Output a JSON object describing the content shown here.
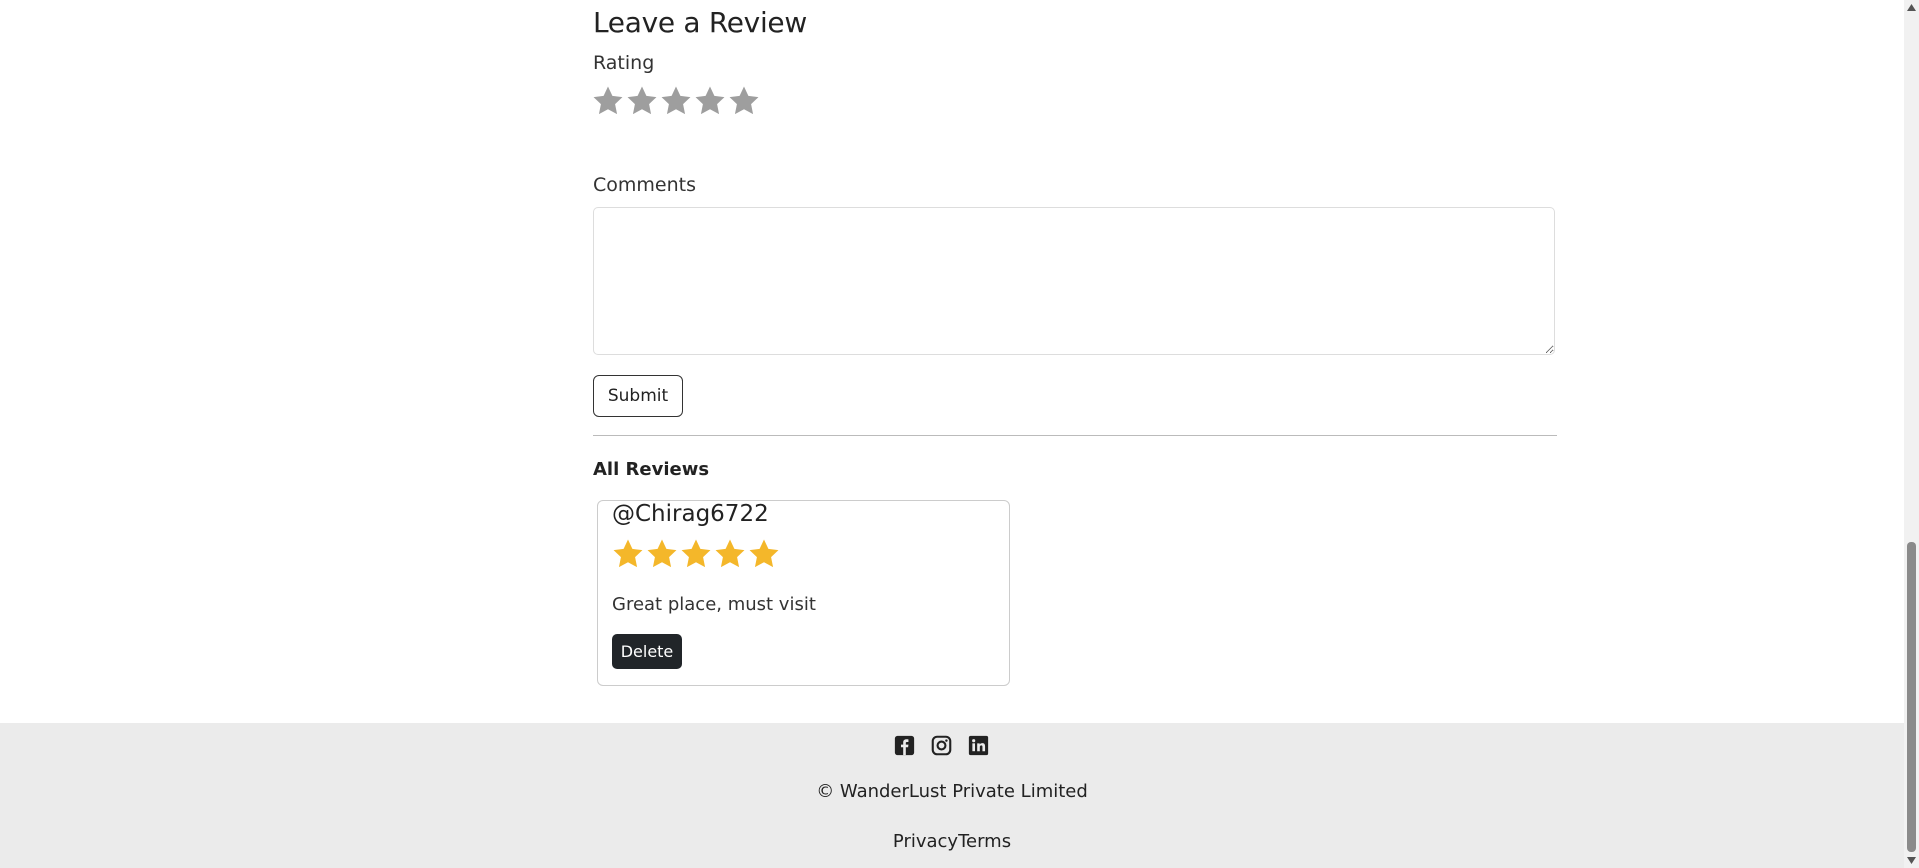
{
  "review_form": {
    "title": "Leave a Review",
    "rating_label": "Rating",
    "rating_value": 0,
    "rating_max": 5,
    "comments_label": "Comments",
    "comments_value": "",
    "submit_label": "Submit"
  },
  "reviews": {
    "heading": "All Reviews",
    "items": [
      {
        "author": "@Chirag6722",
        "rating": 5,
        "rating_max": 5,
        "comment": "Great place, must visit",
        "delete_label": "Delete"
      }
    ]
  },
  "footer": {
    "social_icons": [
      "facebook-icon",
      "instagram-icon",
      "linkedin-icon"
    ],
    "copyright": "© WanderLust Private Limited",
    "links": [
      "Privacy",
      "Terms"
    ]
  },
  "colors": {
    "star_empty": "#9e9e9e",
    "star_filled": "#f4b72a",
    "footer_bg": "#ebebeb",
    "delete_bg": "#212529"
  }
}
